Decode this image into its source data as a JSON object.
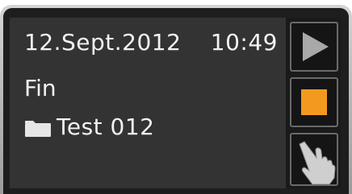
{
  "screen": {
    "date": "12.Sept.2012",
    "time": "10:49",
    "status": "Fin",
    "file_name": "Test 012"
  },
  "icons": {
    "file": "folder-icon",
    "play": "play-icon",
    "stop": "stop-icon",
    "touch": "hand-touch-icon"
  },
  "colors": {
    "screen_background": "#333333",
    "text": "#f2f2f2",
    "stop_accent": "#f39a1e",
    "play_icon": "#a8a8a8"
  }
}
